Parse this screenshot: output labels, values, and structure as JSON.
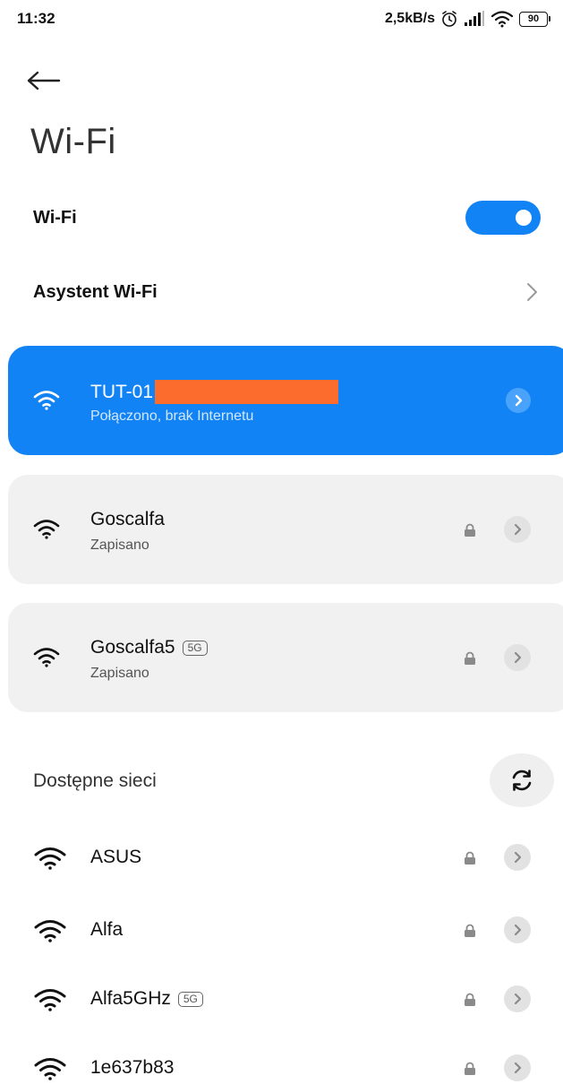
{
  "status_bar": {
    "time": "11:32",
    "net_speed": "2,5kB/s",
    "battery": "90",
    "icons": [
      "alarm-icon",
      "signal-icon",
      "wifi-icon",
      "battery-icon"
    ]
  },
  "header": {
    "back_icon": "arrow-left-icon",
    "title": "Wi-Fi"
  },
  "settings": {
    "wifi_label": "Wi-Fi",
    "wifi_enabled": true,
    "assistant_label": "Asystent Wi-Fi"
  },
  "connected_network": {
    "name": "TUT-01",
    "status": "Połączono, brak Internetu",
    "name_redacted": true
  },
  "saved_networks": [
    {
      "name": "Goscalfa",
      "badge": "",
      "status": "Zapisano",
      "secured": true
    },
    {
      "name": "Goscalfa5",
      "badge": "5G",
      "status": "Zapisano",
      "secured": true
    }
  ],
  "available": {
    "title": "Dostępne sieci",
    "refresh_icon": "refresh-icon",
    "networks": [
      {
        "name": "ASUS",
        "badge": "",
        "secured": true
      },
      {
        "name": "Alfa",
        "badge": "",
        "secured": true
      },
      {
        "name": "Alfa5GHz",
        "badge": "5G",
        "secured": true
      },
      {
        "name": "1e637b83",
        "badge": "",
        "secured": true
      }
    ]
  },
  "colors": {
    "accent": "#1283f5",
    "card_gray": "#f1f1f1",
    "redaction": "#fc6c2c"
  }
}
